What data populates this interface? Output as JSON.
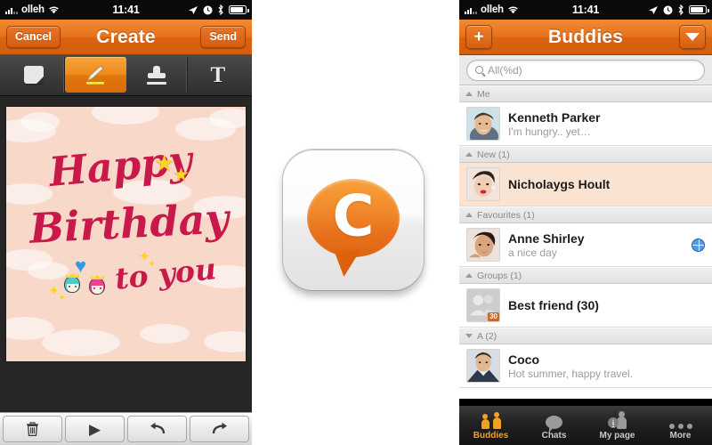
{
  "status_bar": {
    "carrier": "olleh",
    "time": "11:41",
    "icons": [
      "signal-bars-icon",
      "wifi-icon",
      "location-arrow-icon",
      "alarm-clock-icon",
      "bluetooth-icon",
      "battery-icon"
    ]
  },
  "left_phone": {
    "nav": {
      "cancel_label": "Cancel",
      "title": "Create",
      "send_label": "Send"
    },
    "tools": [
      {
        "name": "note-tool",
        "icon": "note-icon",
        "active": false
      },
      {
        "name": "pencil-tool",
        "icon": "pencil-icon",
        "active": true
      },
      {
        "name": "stamp-tool",
        "icon": "stamp-icon",
        "active": false
      },
      {
        "name": "text-tool",
        "icon": "text-T-icon",
        "label": "T",
        "active": false
      }
    ],
    "card": {
      "background_color": "#f7d8c9",
      "text_color": "#c9194a",
      "line1": "Happy",
      "line2": "Birthday",
      "line3": "to you",
      "decorations": [
        "star",
        "star",
        "blue-heart",
        "sparkle",
        "sparkle",
        "princess-teal",
        "princess-pink"
      ]
    },
    "bottom_tools": [
      {
        "name": "delete-button",
        "glyph": "🗑"
      },
      {
        "name": "play-button",
        "glyph": "▶"
      },
      {
        "name": "undo-button",
        "glyph": "↶"
      },
      {
        "name": "redo-button",
        "glyph": "↷"
      }
    ]
  },
  "app_icon": {
    "letter": "C",
    "bubble_color": "#ee7d20",
    "tile_color": "#f2f2f2"
  },
  "right_phone": {
    "nav": {
      "add_label": "+",
      "title": "Buddies",
      "dropdown_icon": "caret-down-icon"
    },
    "search": {
      "placeholder": "All(%d)",
      "icon": "search-icon"
    },
    "sections": [
      {
        "header": "Me",
        "collapsed": false,
        "rows": [
          {
            "name": "Kenneth Parker",
            "status": "I'm hungry.. yet…",
            "highlight": false,
            "globe": false,
            "badge": null
          }
        ]
      },
      {
        "header": "New (1)",
        "collapsed": false,
        "rows": [
          {
            "name": "Nicholaygs Hoult",
            "status": "",
            "highlight": true,
            "globe": false,
            "badge": null
          }
        ]
      },
      {
        "header": "Favourites (1)",
        "collapsed": false,
        "rows": [
          {
            "name": "Anne Shirley",
            "status": "a nice day",
            "highlight": false,
            "globe": true,
            "badge": null
          }
        ]
      },
      {
        "header": "Groups (1)",
        "collapsed": false,
        "rows": [
          {
            "name": "Best friend (30)",
            "status": "",
            "highlight": false,
            "globe": false,
            "badge": "30"
          }
        ]
      },
      {
        "header": "A (2)",
        "collapsed": true,
        "rows": [
          {
            "name": "Coco",
            "status": "Hot summer, happy travel.",
            "highlight": false,
            "globe": false,
            "badge": null
          }
        ]
      }
    ],
    "tabs": [
      {
        "label": "Buddies",
        "icon": "people-icon",
        "active": true
      },
      {
        "label": "Chats",
        "icon": "speech-bubble-icon",
        "active": false
      },
      {
        "label": "My page",
        "icon": "person-info-icon",
        "active": false
      },
      {
        "label": "More",
        "icon": "ellipsis-icon",
        "active": false
      }
    ]
  }
}
